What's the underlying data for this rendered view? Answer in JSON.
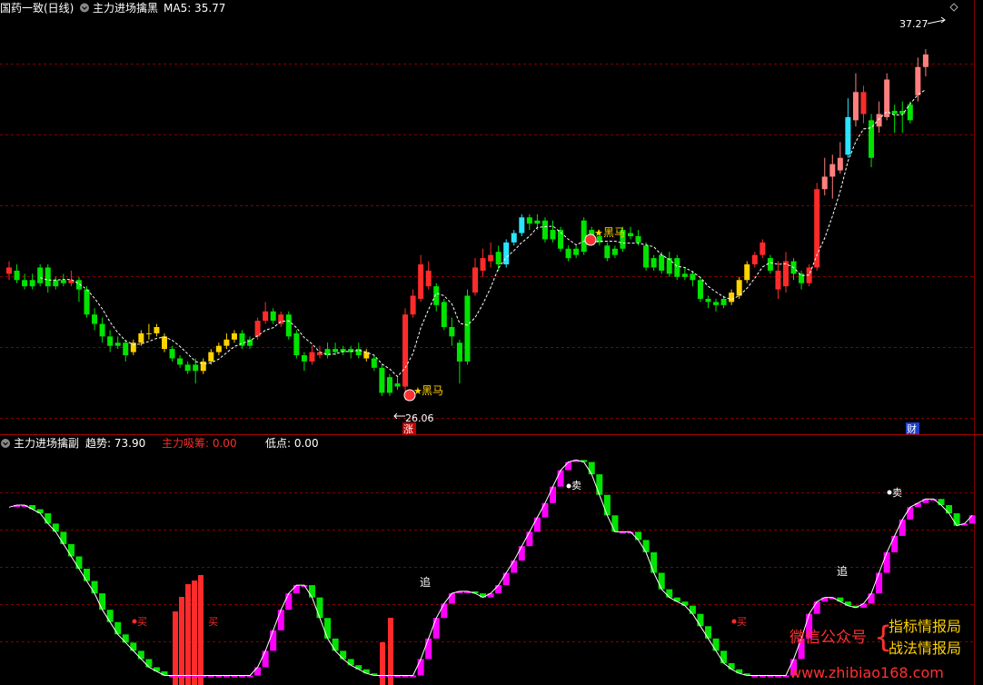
{
  "header": {
    "stock": "国药一致(日线)",
    "indicator": "主力进场擒黑",
    "ma": "MA5: 35.77",
    "high_label": "37.27",
    "low_label": "26.06"
  },
  "sub_header": {
    "indicator": "主力进场擒副",
    "trend": "趋势: 73.90",
    "absorb": "主力吸筹: 0.00",
    "low": "低点: 0.00"
  },
  "signals": {
    "heima": "黑马",
    "zhang": "涨",
    "cai": "财",
    "sell": "卖",
    "chase": "追",
    "buy": "买"
  },
  "watermark": {
    "wechat": "微信公众号",
    "brand1": "指标情报局",
    "brand2": "战法情报局",
    "url": "www.zhibiao168.com"
  },
  "colors": {
    "bg": "#000000",
    "up": "#ff2b2b",
    "down": "#00e400",
    "yellow": "#ffd200",
    "cyan": "#29e6ff",
    "pink": "#ff7f7f",
    "magenta": "#ff00ff",
    "grid": "#800000"
  },
  "chart_data": [
    {
      "type": "candlestick",
      "title": "主力进场擒黑",
      "ylim": [
        25.5,
        38.2
      ],
      "ma5_last": 35.77,
      "annotated_high": 37.27,
      "annotated_low": 26.06,
      "candles": [
        {
          "o": 30.3,
          "c": 30.1,
          "h": 30.5,
          "l": 29.9,
          "col": "up"
        },
        {
          "o": 30.2,
          "c": 29.9,
          "h": 30.4,
          "l": 29.8,
          "col": "down"
        },
        {
          "o": 29.9,
          "c": 29.7,
          "h": 30.1,
          "l": 29.6,
          "col": "down"
        },
        {
          "o": 29.7,
          "c": 29.9,
          "h": 30.1,
          "l": 29.6,
          "col": "down"
        },
        {
          "o": 29.8,
          "c": 30.3,
          "h": 30.4,
          "l": 29.7,
          "col": "down"
        },
        {
          "o": 30.3,
          "c": 29.7,
          "h": 30.4,
          "l": 29.5,
          "col": "down"
        },
        {
          "o": 29.7,
          "c": 29.9,
          "h": 30.0,
          "l": 29.6,
          "col": "down"
        },
        {
          "o": 29.9,
          "c": 29.8,
          "h": 30.1,
          "l": 29.7,
          "col": "down"
        },
        {
          "o": 29.8,
          "c": 29.9,
          "h": 30.2,
          "l": 29.7,
          "col": "up"
        },
        {
          "o": 29.9,
          "c": 29.6,
          "h": 30.0,
          "l": 29.2,
          "col": "down"
        },
        {
          "o": 29.6,
          "c": 28.8,
          "h": 29.7,
          "l": 28.7,
          "col": "down"
        },
        {
          "o": 28.8,
          "c": 28.5,
          "h": 29.0,
          "l": 28.3,
          "col": "down"
        },
        {
          "o": 28.5,
          "c": 28.1,
          "h": 28.7,
          "l": 27.9,
          "col": "down"
        },
        {
          "o": 28.1,
          "c": 27.8,
          "h": 28.3,
          "l": 27.6,
          "col": "down"
        },
        {
          "o": 27.8,
          "c": 27.9,
          "h": 28.1,
          "l": 27.7,
          "col": "down"
        },
        {
          "o": 27.9,
          "c": 27.5,
          "h": 28.0,
          "l": 27.3,
          "col": "down"
        },
        {
          "o": 27.6,
          "c": 27.9,
          "h": 28.0,
          "l": 27.5,
          "col": "yellow"
        },
        {
          "o": 27.9,
          "c": 28.2,
          "h": 28.3,
          "l": 27.8,
          "col": "yellow"
        },
        {
          "o": 28.2,
          "c": 28.2,
          "h": 28.5,
          "l": 28.0,
          "col": "yellow"
        },
        {
          "o": 28.2,
          "c": 28.4,
          "h": 28.5,
          "l": 28.1,
          "col": "yellow"
        },
        {
          "o": 28.1,
          "c": 27.7,
          "h": 28.2,
          "l": 27.6,
          "col": "yellow"
        },
        {
          "o": 27.7,
          "c": 27.4,
          "h": 27.8,
          "l": 27.3,
          "col": "down"
        },
        {
          "o": 27.4,
          "c": 27.2,
          "h": 27.5,
          "l": 27.1,
          "col": "down"
        },
        {
          "o": 27.2,
          "c": 27.0,
          "h": 27.3,
          "l": 26.9,
          "col": "down"
        },
        {
          "o": 27.0,
          "c": 27.2,
          "h": 27.4,
          "l": 26.6,
          "col": "down"
        },
        {
          "o": 27.0,
          "c": 27.3,
          "h": 27.4,
          "l": 26.9,
          "col": "yellow"
        },
        {
          "o": 27.3,
          "c": 27.6,
          "h": 27.7,
          "l": 27.2,
          "col": "yellow"
        },
        {
          "o": 27.6,
          "c": 27.8,
          "h": 27.9,
          "l": 27.5,
          "col": "yellow"
        },
        {
          "o": 27.8,
          "c": 28.0,
          "h": 28.2,
          "l": 27.7,
          "col": "yellow"
        },
        {
          "o": 28.0,
          "c": 28.2,
          "h": 28.3,
          "l": 27.9,
          "col": "yellow"
        },
        {
          "o": 28.2,
          "c": 27.8,
          "h": 28.3,
          "l": 27.7,
          "col": "down"
        },
        {
          "o": 27.8,
          "c": 28.0,
          "h": 28.1,
          "l": 27.7,
          "col": "down"
        },
        {
          "o": 28.1,
          "c": 28.6,
          "h": 28.7,
          "l": 28.0,
          "col": "up"
        },
        {
          "o": 28.6,
          "c": 28.9,
          "h": 29.2,
          "l": 28.5,
          "col": "up"
        },
        {
          "o": 28.9,
          "c": 28.6,
          "h": 29.0,
          "l": 28.5,
          "col": "down"
        },
        {
          "o": 28.5,
          "c": 28.8,
          "h": 28.9,
          "l": 28.4,
          "col": "up"
        },
        {
          "o": 28.8,
          "c": 28.1,
          "h": 28.9,
          "l": 28.0,
          "col": "down"
        },
        {
          "o": 28.2,
          "c": 27.5,
          "h": 28.3,
          "l": 27.4,
          "col": "down"
        },
        {
          "o": 27.5,
          "c": 27.3,
          "h": 27.6,
          "l": 27.0,
          "col": "down"
        },
        {
          "o": 27.3,
          "c": 27.6,
          "h": 27.8,
          "l": 27.2,
          "col": "up"
        },
        {
          "o": 27.6,
          "c": 27.5,
          "h": 27.8,
          "l": 27.4,
          "col": "up"
        },
        {
          "o": 27.5,
          "c": 27.7,
          "h": 27.9,
          "l": 27.4,
          "col": "down"
        },
        {
          "o": 27.7,
          "c": 27.6,
          "h": 27.9,
          "l": 27.5,
          "col": "down"
        },
        {
          "o": 27.6,
          "c": 27.7,
          "h": 27.8,
          "l": 27.5,
          "col": "down"
        },
        {
          "o": 27.7,
          "c": 27.6,
          "h": 27.8,
          "l": 27.4,
          "col": "down"
        },
        {
          "o": 27.5,
          "c": 27.7,
          "h": 27.9,
          "l": 27.4,
          "col": "down"
        },
        {
          "o": 27.6,
          "c": 27.4,
          "h": 27.7,
          "l": 27.3,
          "col": "yellow"
        },
        {
          "o": 27.4,
          "c": 27.1,
          "h": 27.5,
          "l": 27.0,
          "col": "down"
        },
        {
          "o": 27.1,
          "c": 26.3,
          "h": 27.2,
          "l": 26.2,
          "col": "down"
        },
        {
          "o": 26.3,
          "c": 26.8,
          "h": 26.9,
          "l": 26.2,
          "col": "down"
        },
        {
          "o": 26.6,
          "c": 26.5,
          "h": 26.8,
          "l": 26.4,
          "col": "down"
        },
        {
          "o": 26.5,
          "c": 28.8,
          "h": 29.0,
          "l": 26.06,
          "col": "up"
        },
        {
          "o": 28.8,
          "c": 29.4,
          "h": 29.6,
          "l": 28.7,
          "col": "up"
        },
        {
          "o": 29.3,
          "c": 30.4,
          "h": 30.7,
          "l": 29.2,
          "col": "up"
        },
        {
          "o": 30.2,
          "c": 29.7,
          "h": 30.5,
          "l": 29.6,
          "col": "up"
        },
        {
          "o": 29.7,
          "c": 29.1,
          "h": 29.8,
          "l": 28.9,
          "col": "down"
        },
        {
          "o": 29.2,
          "c": 28.4,
          "h": 29.3,
          "l": 28.3,
          "col": "down"
        },
        {
          "o": 28.4,
          "c": 28.1,
          "h": 28.7,
          "l": 27.8,
          "col": "down"
        },
        {
          "o": 27.9,
          "c": 27.3,
          "h": 28.0,
          "l": 26.6,
          "col": "down"
        },
        {
          "o": 27.3,
          "c": 29.4,
          "h": 29.6,
          "l": 27.2,
          "col": "down"
        },
        {
          "o": 29.5,
          "c": 30.3,
          "h": 30.6,
          "l": 29.4,
          "col": "up"
        },
        {
          "o": 30.2,
          "c": 30.6,
          "h": 30.9,
          "l": 30.0,
          "col": "up"
        },
        {
          "o": 30.5,
          "c": 30.7,
          "h": 31.1,
          "l": 30.3,
          "col": "up"
        },
        {
          "o": 30.8,
          "c": 30.4,
          "h": 31.0,
          "l": 30.2,
          "col": "down"
        },
        {
          "o": 30.4,
          "c": 31.1,
          "h": 31.2,
          "l": 30.3,
          "col": "cyan"
        },
        {
          "o": 31.1,
          "c": 31.4,
          "h": 31.5,
          "l": 31.0,
          "col": "cyan"
        },
        {
          "o": 31.4,
          "c": 31.9,
          "h": 32.0,
          "l": 31.3,
          "col": "cyan"
        },
        {
          "o": 31.9,
          "c": 31.7,
          "h": 32.0,
          "l": 31.5,
          "col": "down"
        },
        {
          "o": 31.7,
          "c": 31.8,
          "h": 32.0,
          "l": 31.5,
          "col": "down"
        },
        {
          "o": 31.8,
          "c": 31.2,
          "h": 31.9,
          "l": 31.1,
          "col": "down"
        },
        {
          "o": 31.2,
          "c": 31.5,
          "h": 31.8,
          "l": 31.1,
          "col": "down"
        },
        {
          "o": 31.5,
          "c": 30.9,
          "h": 31.6,
          "l": 30.8,
          "col": "down"
        },
        {
          "o": 30.9,
          "c": 30.6,
          "h": 31.0,
          "l": 30.5,
          "col": "down"
        },
        {
          "o": 30.7,
          "c": 30.9,
          "h": 31.0,
          "l": 30.6,
          "col": "down"
        },
        {
          "o": 30.8,
          "c": 31.8,
          "h": 31.9,
          "l": 30.7,
          "col": "down"
        },
        {
          "o": 31.5,
          "c": 31.3,
          "h": 31.6,
          "l": 31.2,
          "col": "down"
        },
        {
          "o": 31.3,
          "c": 31.1,
          "h": 31.5,
          "l": 31.0,
          "col": "down"
        },
        {
          "o": 31.0,
          "c": 30.6,
          "h": 31.1,
          "l": 30.5,
          "col": "down"
        },
        {
          "o": 30.7,
          "c": 30.9,
          "h": 31.0,
          "l": 30.6,
          "col": "down"
        },
        {
          "o": 30.9,
          "c": 31.5,
          "h": 31.6,
          "l": 30.8,
          "col": "down"
        },
        {
          "o": 31.4,
          "c": 31.3,
          "h": 31.6,
          "l": 31.2,
          "col": "down"
        },
        {
          "o": 31.3,
          "c": 31.1,
          "h": 31.5,
          "l": 31.0,
          "col": "down"
        },
        {
          "o": 31.0,
          "c": 30.3,
          "h": 31.1,
          "l": 30.2,
          "col": "down"
        },
        {
          "o": 30.3,
          "c": 30.6,
          "h": 30.7,
          "l": 30.2,
          "col": "down"
        },
        {
          "o": 30.7,
          "c": 30.2,
          "h": 30.8,
          "l": 30.1,
          "col": "down"
        },
        {
          "o": 30.1,
          "c": 30.6,
          "h": 30.8,
          "l": 30.0,
          "col": "down"
        },
        {
          "o": 30.6,
          "c": 30.0,
          "h": 30.7,
          "l": 29.9,
          "col": "down"
        },
        {
          "o": 30.0,
          "c": 30.1,
          "h": 30.3,
          "l": 29.9,
          "col": "down"
        },
        {
          "o": 30.1,
          "c": 29.9,
          "h": 30.2,
          "l": 29.7,
          "col": "down"
        },
        {
          "o": 29.9,
          "c": 29.3,
          "h": 30.0,
          "l": 29.2,
          "col": "down"
        },
        {
          "o": 29.3,
          "c": 29.2,
          "h": 29.4,
          "l": 29.0,
          "col": "down"
        },
        {
          "o": 29.2,
          "c": 29.1,
          "h": 29.3,
          "l": 28.9,
          "col": "down"
        },
        {
          "o": 29.1,
          "c": 29.3,
          "h": 29.4,
          "l": 29.0,
          "col": "down"
        },
        {
          "o": 29.2,
          "c": 29.5,
          "h": 29.6,
          "l": 29.1,
          "col": "yellow"
        },
        {
          "o": 29.4,
          "c": 29.9,
          "h": 30.0,
          "l": 29.3,
          "col": "yellow"
        },
        {
          "o": 29.9,
          "c": 30.4,
          "h": 30.5,
          "l": 29.8,
          "col": "yellow"
        },
        {
          "o": 30.4,
          "c": 30.7,
          "h": 30.8,
          "l": 30.3,
          "col": "up"
        },
        {
          "o": 30.7,
          "c": 31.1,
          "h": 31.2,
          "l": 30.6,
          "col": "up"
        },
        {
          "o": 30.6,
          "c": 30.2,
          "h": 30.7,
          "l": 30.1,
          "col": "down"
        },
        {
          "o": 30.2,
          "c": 29.6,
          "h": 30.5,
          "l": 29.3,
          "col": "up"
        },
        {
          "o": 29.7,
          "c": 30.5,
          "h": 30.8,
          "l": 29.5,
          "col": "up"
        },
        {
          "o": 30.5,
          "c": 30.1,
          "h": 30.6,
          "l": 29.9,
          "col": "down"
        },
        {
          "o": 30.1,
          "c": 29.8,
          "h": 30.2,
          "l": 29.6,
          "col": "down"
        },
        {
          "o": 29.8,
          "c": 30.3,
          "h": 30.4,
          "l": 29.7,
          "col": "up"
        },
        {
          "o": 30.3,
          "c": 32.8,
          "h": 33.0,
          "l": 30.2,
          "col": "up"
        },
        {
          "o": 32.8,
          "c": 33.2,
          "h": 33.8,
          "l": 32.6,
          "col": "pink"
        },
        {
          "o": 33.2,
          "c": 33.6,
          "h": 33.9,
          "l": 32.5,
          "col": "pink"
        },
        {
          "o": 33.4,
          "c": 33.8,
          "h": 34.3,
          "l": 33.3,
          "col": "pink"
        },
        {
          "o": 33.9,
          "c": 35.1,
          "h": 35.7,
          "l": 33.8,
          "col": "cyan"
        },
        {
          "o": 35.0,
          "c": 35.9,
          "h": 36.5,
          "l": 34.8,
          "col": "pink"
        },
        {
          "o": 35.9,
          "c": 35.2,
          "h": 36.1,
          "l": 34.9,
          "col": "up"
        },
        {
          "o": 35.0,
          "c": 33.8,
          "h": 35.2,
          "l": 33.5,
          "col": "down"
        },
        {
          "o": 34.8,
          "c": 35.2,
          "h": 35.6,
          "l": 34.6,
          "col": "pink"
        },
        {
          "o": 35.1,
          "c": 36.3,
          "h": 36.5,
          "l": 35.0,
          "col": "pink"
        },
        {
          "o": 35.2,
          "c": 35.3,
          "h": 35.5,
          "l": 34.6,
          "col": "down"
        },
        {
          "o": 35.2,
          "c": 35.3,
          "h": 35.6,
          "l": 34.6,
          "col": "down"
        },
        {
          "o": 35.0,
          "c": 35.5,
          "h": 35.6,
          "l": 34.9,
          "col": "down"
        },
        {
          "o": 35.8,
          "c": 36.7,
          "h": 37.0,
          "l": 35.6,
          "col": "pink"
        },
        {
          "o": 36.7,
          "c": 37.1,
          "h": 37.27,
          "l": 36.4,
          "col": "pink"
        }
      ],
      "signals": [
        {
          "index": 52,
          "text": "黑马"
        },
        {
          "index": 79,
          "text": "黑马"
        }
      ]
    },
    {
      "type": "bar",
      "title": "主力进场擒副",
      "ylim": [
        -2,
        110
      ],
      "trend_last": 73.9,
      "trend_values": [
        82,
        83,
        83,
        81,
        79,
        74,
        70,
        64,
        58,
        52,
        46,
        40,
        32,
        26,
        20,
        16,
        12,
        8,
        4,
        2,
        0,
        0,
        0,
        0,
        0,
        0,
        0,
        0,
        0,
        0,
        0,
        0,
        4,
        12,
        22,
        32,
        40,
        44,
        44,
        38,
        28,
        18,
        12,
        8,
        5,
        3,
        1,
        0,
        0,
        0,
        0,
        0,
        0,
        8,
        18,
        28,
        35,
        40,
        41,
        41,
        40,
        38,
        40,
        44,
        50,
        56,
        63,
        70,
        77,
        84,
        92,
        100,
        104,
        105,
        104,
        98,
        88,
        78,
        70,
        70,
        70,
        66,
        60,
        50,
        42,
        38,
        36,
        34,
        30,
        24,
        18,
        12,
        6,
        3,
        1,
        0,
        0,
        0,
        0,
        0,
        0,
        8,
        18,
        30,
        36,
        38,
        38,
        36,
        34,
        33,
        35,
        40,
        50,
        60,
        68,
        76,
        82,
        84,
        86,
        86,
        83,
        79,
        73,
        74,
        78
      ]
    }
  ]
}
